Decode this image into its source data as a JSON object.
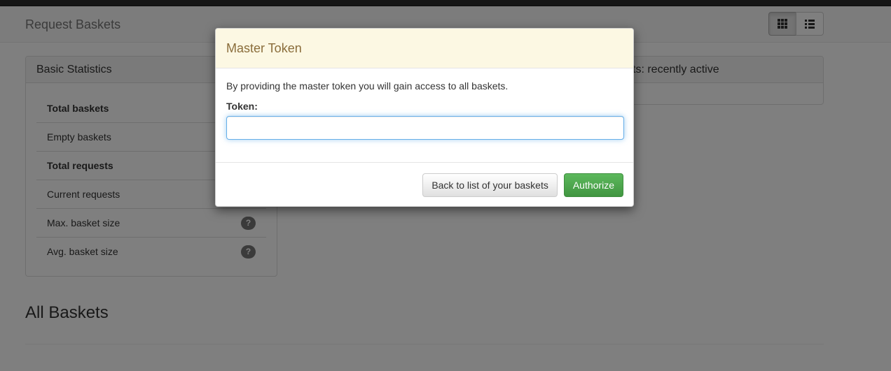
{
  "header": {
    "brand": "Request Baskets",
    "view_toggle": {
      "grid_icon": "grid-icon",
      "list_icon": "list-icon",
      "active": "grid"
    }
  },
  "stats_panel": {
    "title": "Basic Statistics",
    "rows": [
      {
        "label": "Total baskets",
        "bold": true
      },
      {
        "label": "Empty baskets",
        "bold": false
      },
      {
        "label": "Total requests",
        "bold": true
      },
      {
        "label": "Current requests",
        "bold": false
      },
      {
        "label": "Max. basket size",
        "bold": false,
        "help": "?"
      },
      {
        "label": "Avg. basket size",
        "bold": false,
        "help": "?"
      }
    ]
  },
  "recent_panel": {
    "title": "ts: recently active"
  },
  "section": {
    "title": "All Baskets"
  },
  "modal": {
    "title": "Master Token",
    "description": "By providing the master token you will gain access to all baskets.",
    "token_label": "Token:",
    "token_value": "",
    "back_button": "Back to list of your baskets",
    "authorize_button": "Authorize"
  },
  "colors": {
    "modal_header_bg": "#fcf8e3",
    "modal_title": "#8a6d3b",
    "authorize_bg": "#5cb85c",
    "input_focus": "#66afe9"
  }
}
